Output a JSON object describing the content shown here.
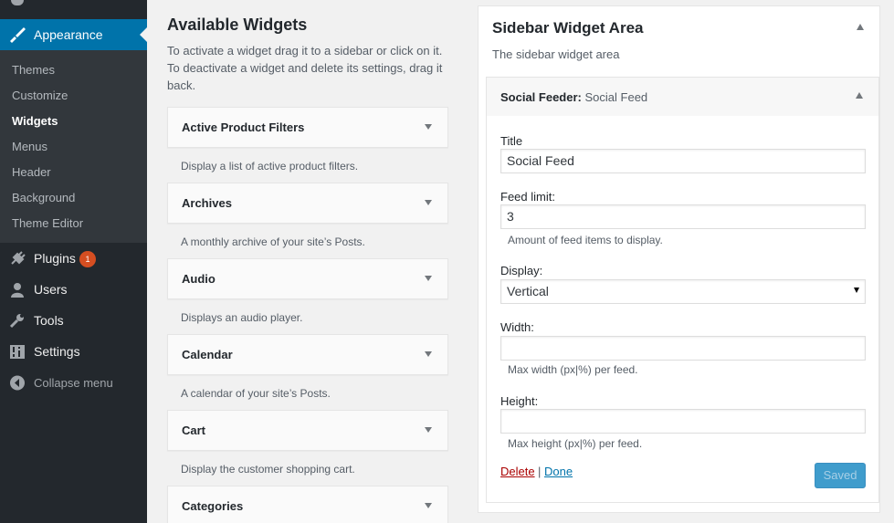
{
  "menu": {
    "current": "Appearance",
    "submenu": [
      "Themes",
      "Customize",
      "Widgets",
      "Menus",
      "Header",
      "Background",
      "Theme Editor"
    ],
    "items": [
      {
        "label": "Plugins",
        "badge": "1"
      },
      {
        "label": "Users"
      },
      {
        "label": "Tools"
      },
      {
        "label": "Settings"
      },
      {
        "label": "Collapse menu"
      }
    ]
  },
  "available": {
    "title": "Available Widgets",
    "description": "To activate a widget drag it to a sidebar or click on it. To deactivate a widget and delete its settings, drag it back.",
    "widgets": [
      {
        "title": "Active Product Filters",
        "desc": "Display a list of active product filters."
      },
      {
        "title": "Archives",
        "desc": "A monthly archive of your site’s Posts."
      },
      {
        "title": "Audio",
        "desc": "Displays an audio player."
      },
      {
        "title": "Calendar",
        "desc": "A calendar of your site’s Posts."
      },
      {
        "title": "Cart",
        "desc": "Display the customer shopping cart."
      },
      {
        "title": "Categories",
        "desc": ""
      }
    ]
  },
  "area": {
    "title": "Sidebar Widget Area",
    "description": "The sidebar widget area",
    "widget": {
      "name": "Social Feeder",
      "sep": ":",
      "instance": "Social Feed",
      "fields": {
        "title_label": "Title",
        "title_value": "Social Feed",
        "limit_label": "Feed limit:",
        "limit_value": "3",
        "limit_help": "Amount of feed items to display.",
        "display_label": "Display:",
        "display_value": "Vertical",
        "width_label": "Width:",
        "width_value": "",
        "width_help": "Max width (px|%) per feed.",
        "height_label": "Height:",
        "height_value": "",
        "height_help": "Max height (px|%) per feed."
      },
      "delete_label": "Delete",
      "separator": "|",
      "done_label": "Done",
      "saved_label": "Saved"
    }
  }
}
